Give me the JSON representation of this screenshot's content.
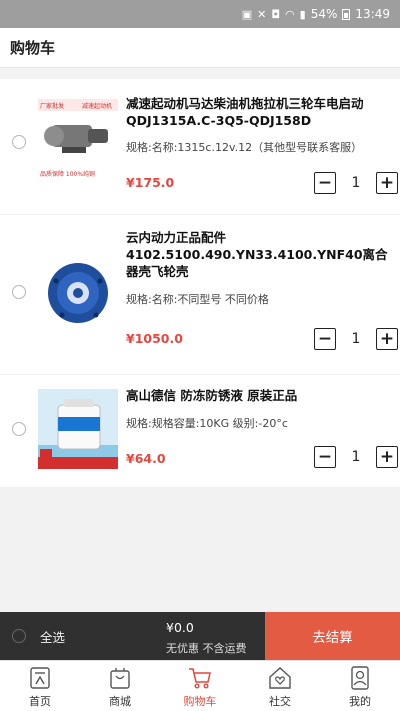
{
  "status_bar": {
    "battery": "54%",
    "time": "13:49"
  },
  "header": {
    "title": "购物车"
  },
  "cart_items": [
    {
      "name": "减速起动机马达柴油机拖拉机三轮车电启动QDJ1315A.C-3Q5-QDJ158D",
      "spec": "规格:名称:1315c.12v.12（其他型号联系客服）",
      "price": "¥175.0",
      "qty": "1",
      "thumb_text": {
        "line1": "厂家批发",
        "line2": "减速起动机",
        "line3": "品质保障 100%纯铜"
      }
    },
    {
      "name": "云内动力正品配件4102.5100.490.YN33.4100.YNF40离合器壳飞轮壳",
      "spec": "规格:名称:不同型号 不同价格",
      "price": "¥1050.0",
      "qty": "1"
    },
    {
      "name": "高山德信 防冻防锈液  原装正品",
      "spec": "规格:规格容量:10KG 级别:-20°c",
      "price": "¥64.0",
      "qty": "1"
    }
  ],
  "stepper": {
    "minus": "−",
    "plus": "+"
  },
  "checkout": {
    "select_all": "全选",
    "total": "¥0.0",
    "note": "无优惠 不含运费",
    "button": "去结算"
  },
  "tabs": [
    {
      "label": "首页",
      "icon": "home-icon",
      "active": false
    },
    {
      "label": "商城",
      "icon": "shopping-bag-icon",
      "active": false
    },
    {
      "label": "购物车",
      "icon": "cart-icon",
      "active": true
    },
    {
      "label": "社交",
      "icon": "house-heart-icon",
      "active": false
    },
    {
      "label": "我的",
      "icon": "user-icon",
      "active": false
    }
  ],
  "colors": {
    "accent": "#e8453c",
    "checkout_button": "#e45b44",
    "checkout_bar": "#303030"
  }
}
